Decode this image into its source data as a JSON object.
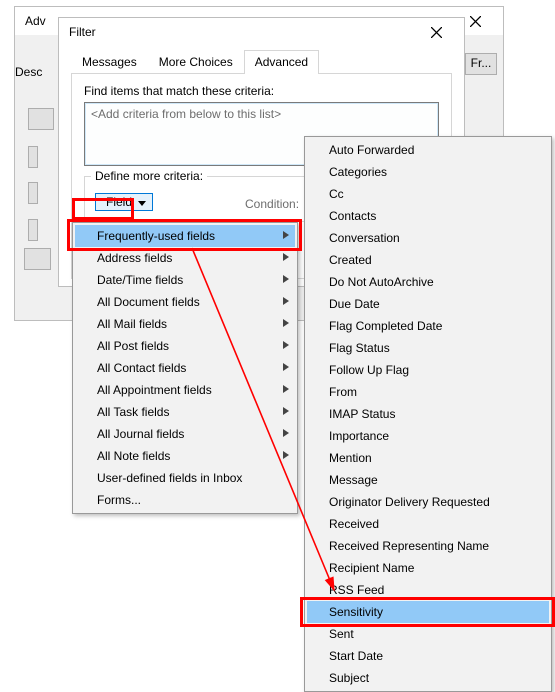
{
  "advfind": {
    "title": "Adv",
    "desc_label": "Desc",
    "browse_label": "Fr..."
  },
  "filter": {
    "title": "Filter",
    "tabs": {
      "messages": "Messages",
      "more": "More Choices",
      "advanced": "Advanced"
    },
    "criteria_label": "Find items that match these criteria:",
    "criteria_placeholder": "<Add criteria from below to this list>",
    "group_title": "Define more criteria:",
    "field_button": "Field",
    "condition_label": "Condition:"
  },
  "fields_menu": [
    "Frequently-used fields",
    "Address fields",
    "Date/Time fields",
    "All Document fields",
    "All Mail fields",
    "All Post fields",
    "All Contact fields",
    "All Appointment fields",
    "All Task fields",
    "All Journal fields",
    "All Note fields",
    "User-defined fields in Inbox",
    "Forms..."
  ],
  "values_menu": [
    "Auto Forwarded",
    "Categories",
    "Cc",
    "Contacts",
    "Conversation",
    "Created",
    "Do Not AutoArchive",
    "Due Date",
    "Flag Completed Date",
    "Flag Status",
    "Follow Up Flag",
    "From",
    "IMAP Status",
    "Importance",
    "Mention",
    "Message",
    "Originator Delivery Requested",
    "Received",
    "Received Representing Name",
    "Recipient Name",
    "RSS Feed",
    "Sensitivity",
    "Sent",
    "Start Date",
    "Subject"
  ],
  "highlight": {
    "fields_index": 0,
    "values_index": 21
  }
}
